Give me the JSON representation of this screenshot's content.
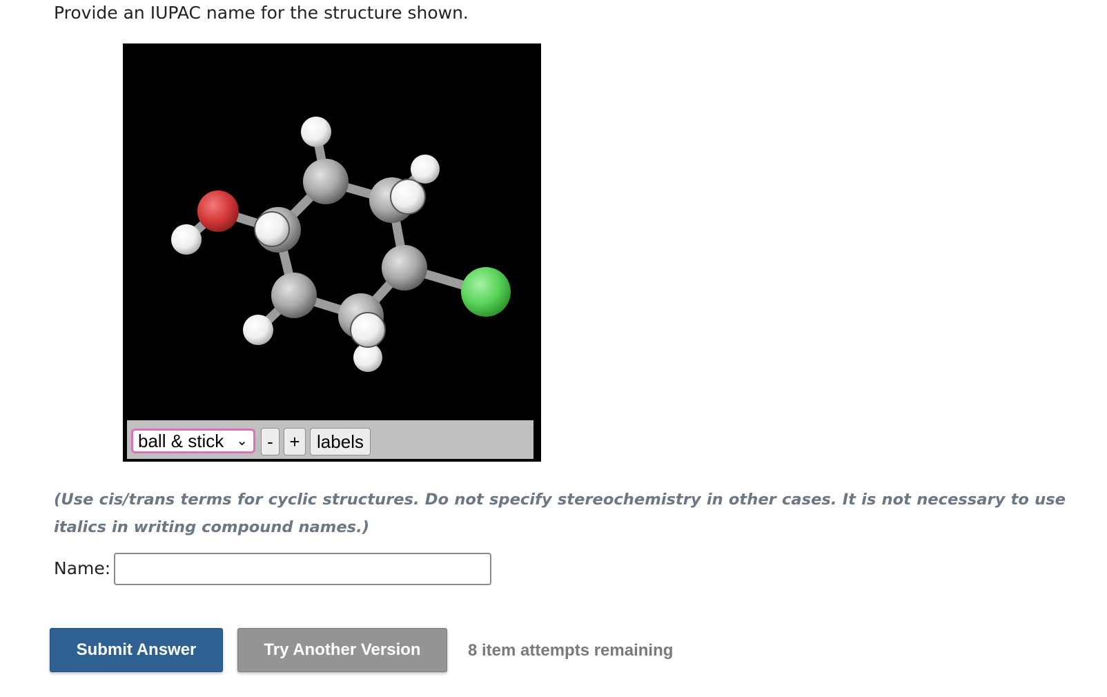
{
  "question": {
    "prompt": "Provide an IUPAC name for the structure shown."
  },
  "viewer": {
    "background": "#000000",
    "toolbar": {
      "style_select_value": "ball & stick",
      "zoom_out_label": "-",
      "zoom_in_label": "+",
      "labels_label": "labels"
    },
    "atom_colors": {
      "carbon": "#a6a6a6",
      "hydrogen": "#f2f2f2",
      "oxygen": "#d63a3a",
      "chlorine": "#5ad45a"
    }
  },
  "instructions": "(Use cis/trans terms for cyclic structures. Do not specify stereochemistry in other cases. It is not necessary to use italics in writing compound names.)",
  "answer": {
    "label": "Name:",
    "value": "",
    "placeholder": ""
  },
  "actions": {
    "submit_label": "Submit Answer",
    "try_another_label": "Try Another Version",
    "attempts_text": "8 item attempts remaining"
  }
}
